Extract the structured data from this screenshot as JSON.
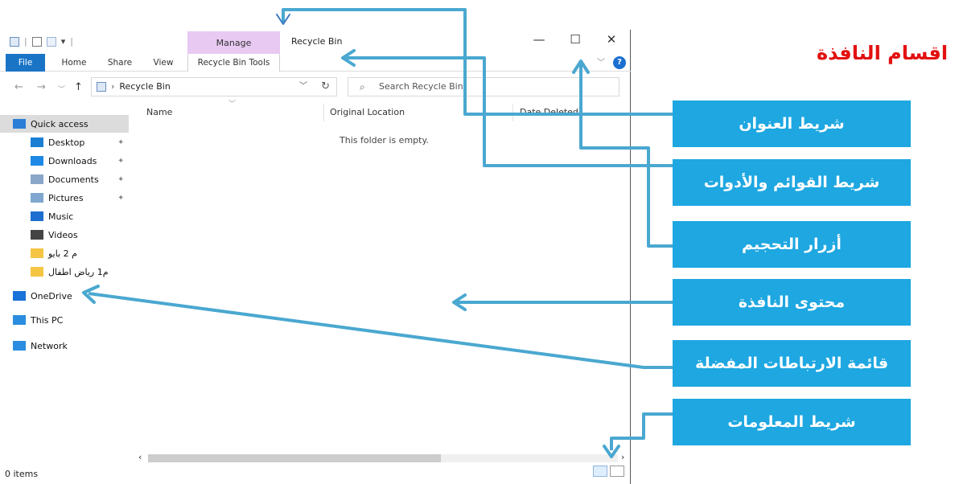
{
  "heading": "اقسام النافذة",
  "window": {
    "title": "Recycle Bin",
    "manage_tab": "Manage",
    "tabs": [
      "File",
      "Home",
      "Share",
      "View",
      "Recycle Bin Tools"
    ],
    "controls": {
      "minimize": "—",
      "maximize": "☐",
      "close": "✕",
      "help": "?"
    },
    "address_path": "Recycle Bin",
    "search_placeholder": "Search Recycle Bin",
    "columns": [
      "Name",
      "Original Location",
      "Date Deleted"
    ],
    "empty_message": "This folder is empty.",
    "status": "0 items"
  },
  "sidebar": [
    {
      "label": "Quick access",
      "icon": "star-icon",
      "color": "#2b7fd6"
    },
    {
      "label": "Desktop",
      "icon": "desktop-icon",
      "color": "#1b7fd4"
    },
    {
      "label": "Downloads",
      "icon": "download-icon",
      "color": "#1e88e5"
    },
    {
      "label": "Documents",
      "icon": "documents-icon",
      "color": "#8aa6c8"
    },
    {
      "label": "Pictures",
      "icon": "pictures-icon",
      "color": "#7fa7cf"
    },
    {
      "label": "Music",
      "icon": "music-icon",
      "color": "#1e6fcf"
    },
    {
      "label": "Videos",
      "icon": "videos-icon",
      "color": "#444"
    },
    {
      "label": "م 2 بايو",
      "icon": "folder-icon",
      "color": "#f4c542"
    },
    {
      "label": "م1 رياض اطفال",
      "icon": "folder-icon",
      "color": "#f4c542"
    },
    {
      "label": "OneDrive",
      "icon": "cloud-icon",
      "color": "#1a73d9"
    },
    {
      "label": "This PC",
      "icon": "computer-icon",
      "color": "#2a8de0"
    },
    {
      "label": "Network",
      "icon": "network-icon",
      "color": "#2a8de0"
    }
  ],
  "annotations": [
    "شريط العنوان",
    "شريط القوائم والأدوات",
    "أزرار التحجيم",
    "محتوى النافذة",
    "قائمة الارتباطات المفضلة",
    "شريط المعلومات"
  ],
  "colors": {
    "arrow": "#4aa8d0",
    "label_bg": "#1ea7e1",
    "heading": "#e31010",
    "file_tab": "#1a74c6",
    "manage_tab": "#e7c9f2"
  }
}
